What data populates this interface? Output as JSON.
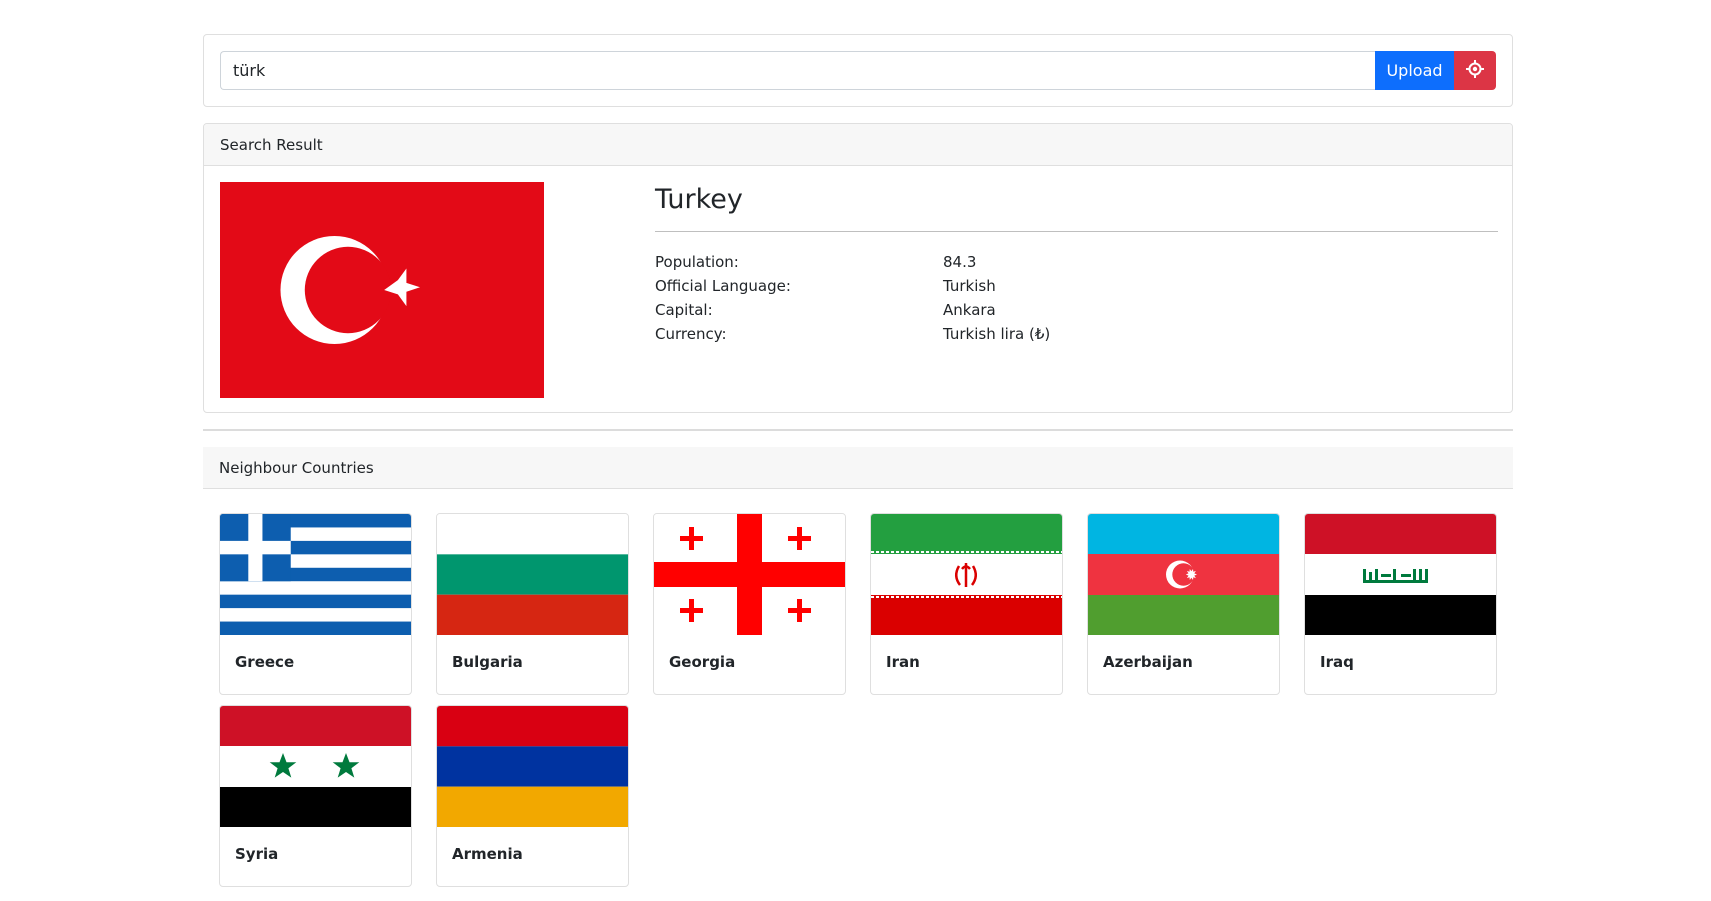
{
  "search": {
    "value": "türk",
    "upload_label": "Upload",
    "locate_icon": "crosshair-icon"
  },
  "result": {
    "header": "Search Result",
    "country": "Turkey",
    "flag": "flag-turkey",
    "fields": [
      {
        "label": "Population:",
        "value": "84.3"
      },
      {
        "label": "Official Language:",
        "value": "Turkish"
      },
      {
        "label": "Capital:",
        "value": "Ankara"
      },
      {
        "label": "Currency:",
        "value": "Turkish lira (₺)"
      }
    ]
  },
  "neighbours": {
    "header": "Neighbour Countries",
    "countries": [
      {
        "name": "Greece",
        "flag": "flag-greece"
      },
      {
        "name": "Bulgaria",
        "flag": "flag-bulgaria"
      },
      {
        "name": "Georgia",
        "flag": "flag-georgia"
      },
      {
        "name": "Iran",
        "flag": "flag-iran"
      },
      {
        "name": "Azerbaijan",
        "flag": "flag-azerbaijan"
      },
      {
        "name": "Iraq",
        "flag": "flag-iraq"
      },
      {
        "name": "Syria",
        "flag": "flag-syria"
      },
      {
        "name": "Armenia",
        "flag": "flag-armenia"
      }
    ]
  },
  "colors": {
    "primary": "#0d6efd",
    "danger": "#dc3545",
    "turkey_red": "#e30a17"
  }
}
